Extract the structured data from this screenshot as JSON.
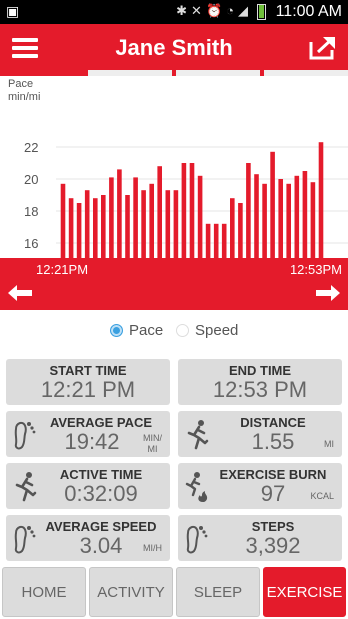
{
  "status_bar": {
    "left_icon": "notification-icon",
    "icons": [
      "bluetooth-icon",
      "mute-icon",
      "alarm-icon",
      "wifi-icon",
      "signal-icon"
    ],
    "time": "11:00 AM"
  },
  "header": {
    "title": "Jane Smith",
    "menu_icon": "hamburger-icon",
    "share_icon": "share-icon",
    "color": "#e41b2b"
  },
  "chart": {
    "ylabel_line1": "Pace",
    "ylabel_line2": "min/mi",
    "y_ticks": [
      "22",
      "20",
      "18",
      "16"
    ],
    "start_time": "12:21PM",
    "end_time": "12:53PM"
  },
  "chart_data": {
    "type": "bar",
    "title": "",
    "xlabel": "",
    "ylabel": "Pace min/mi",
    "ylim": [
      15,
      24
    ],
    "x_range": [
      "12:21PM",
      "12:53PM"
    ],
    "values": [
      19.7,
      18.8,
      18.5,
      19.3,
      18.8,
      19.0,
      20.1,
      20.6,
      19.0,
      20.1,
      19.3,
      19.7,
      20.8,
      19.3,
      19.3,
      21.0,
      21.0,
      20.2,
      17.2,
      17.2,
      17.2,
      18.8,
      18.5,
      21.0,
      20.3,
      19.7,
      21.7,
      20.0,
      19.7,
      20.2,
      20.5,
      19.8,
      22.3
    ],
    "bar_color": "#e41b2b"
  },
  "radios": {
    "pace_label": "Pace",
    "speed_label": "Speed",
    "selected": "Pace"
  },
  "stats": {
    "start_time": {
      "label": "START TIME",
      "value": "12:21 PM"
    },
    "end_time": {
      "label": "END TIME",
      "value": "12:53 PM"
    },
    "average_pace": {
      "label": "AVERAGE PACE",
      "value": "19:42",
      "unit_line1": "MIN/",
      "unit_line2": "MI"
    },
    "distance": {
      "label": "DISTANCE",
      "value": "1.55",
      "unit": "MI"
    },
    "active_time": {
      "label": "ACTIVE TIME",
      "value": "0:32:09"
    },
    "exercise_burn": {
      "label": "EXERCISE BURN",
      "value": "97",
      "unit": "KCAL"
    },
    "average_speed": {
      "label": "AVERAGE SPEED",
      "value": "3.04",
      "unit": "MI/H"
    },
    "steps": {
      "label": "STEPS",
      "value": "3,392"
    }
  },
  "nav": {
    "home": "HOME",
    "activity": "ACTIVITY",
    "sleep": "SLEEP",
    "exercise": "EXERCISE",
    "active": "EXERCISE"
  }
}
